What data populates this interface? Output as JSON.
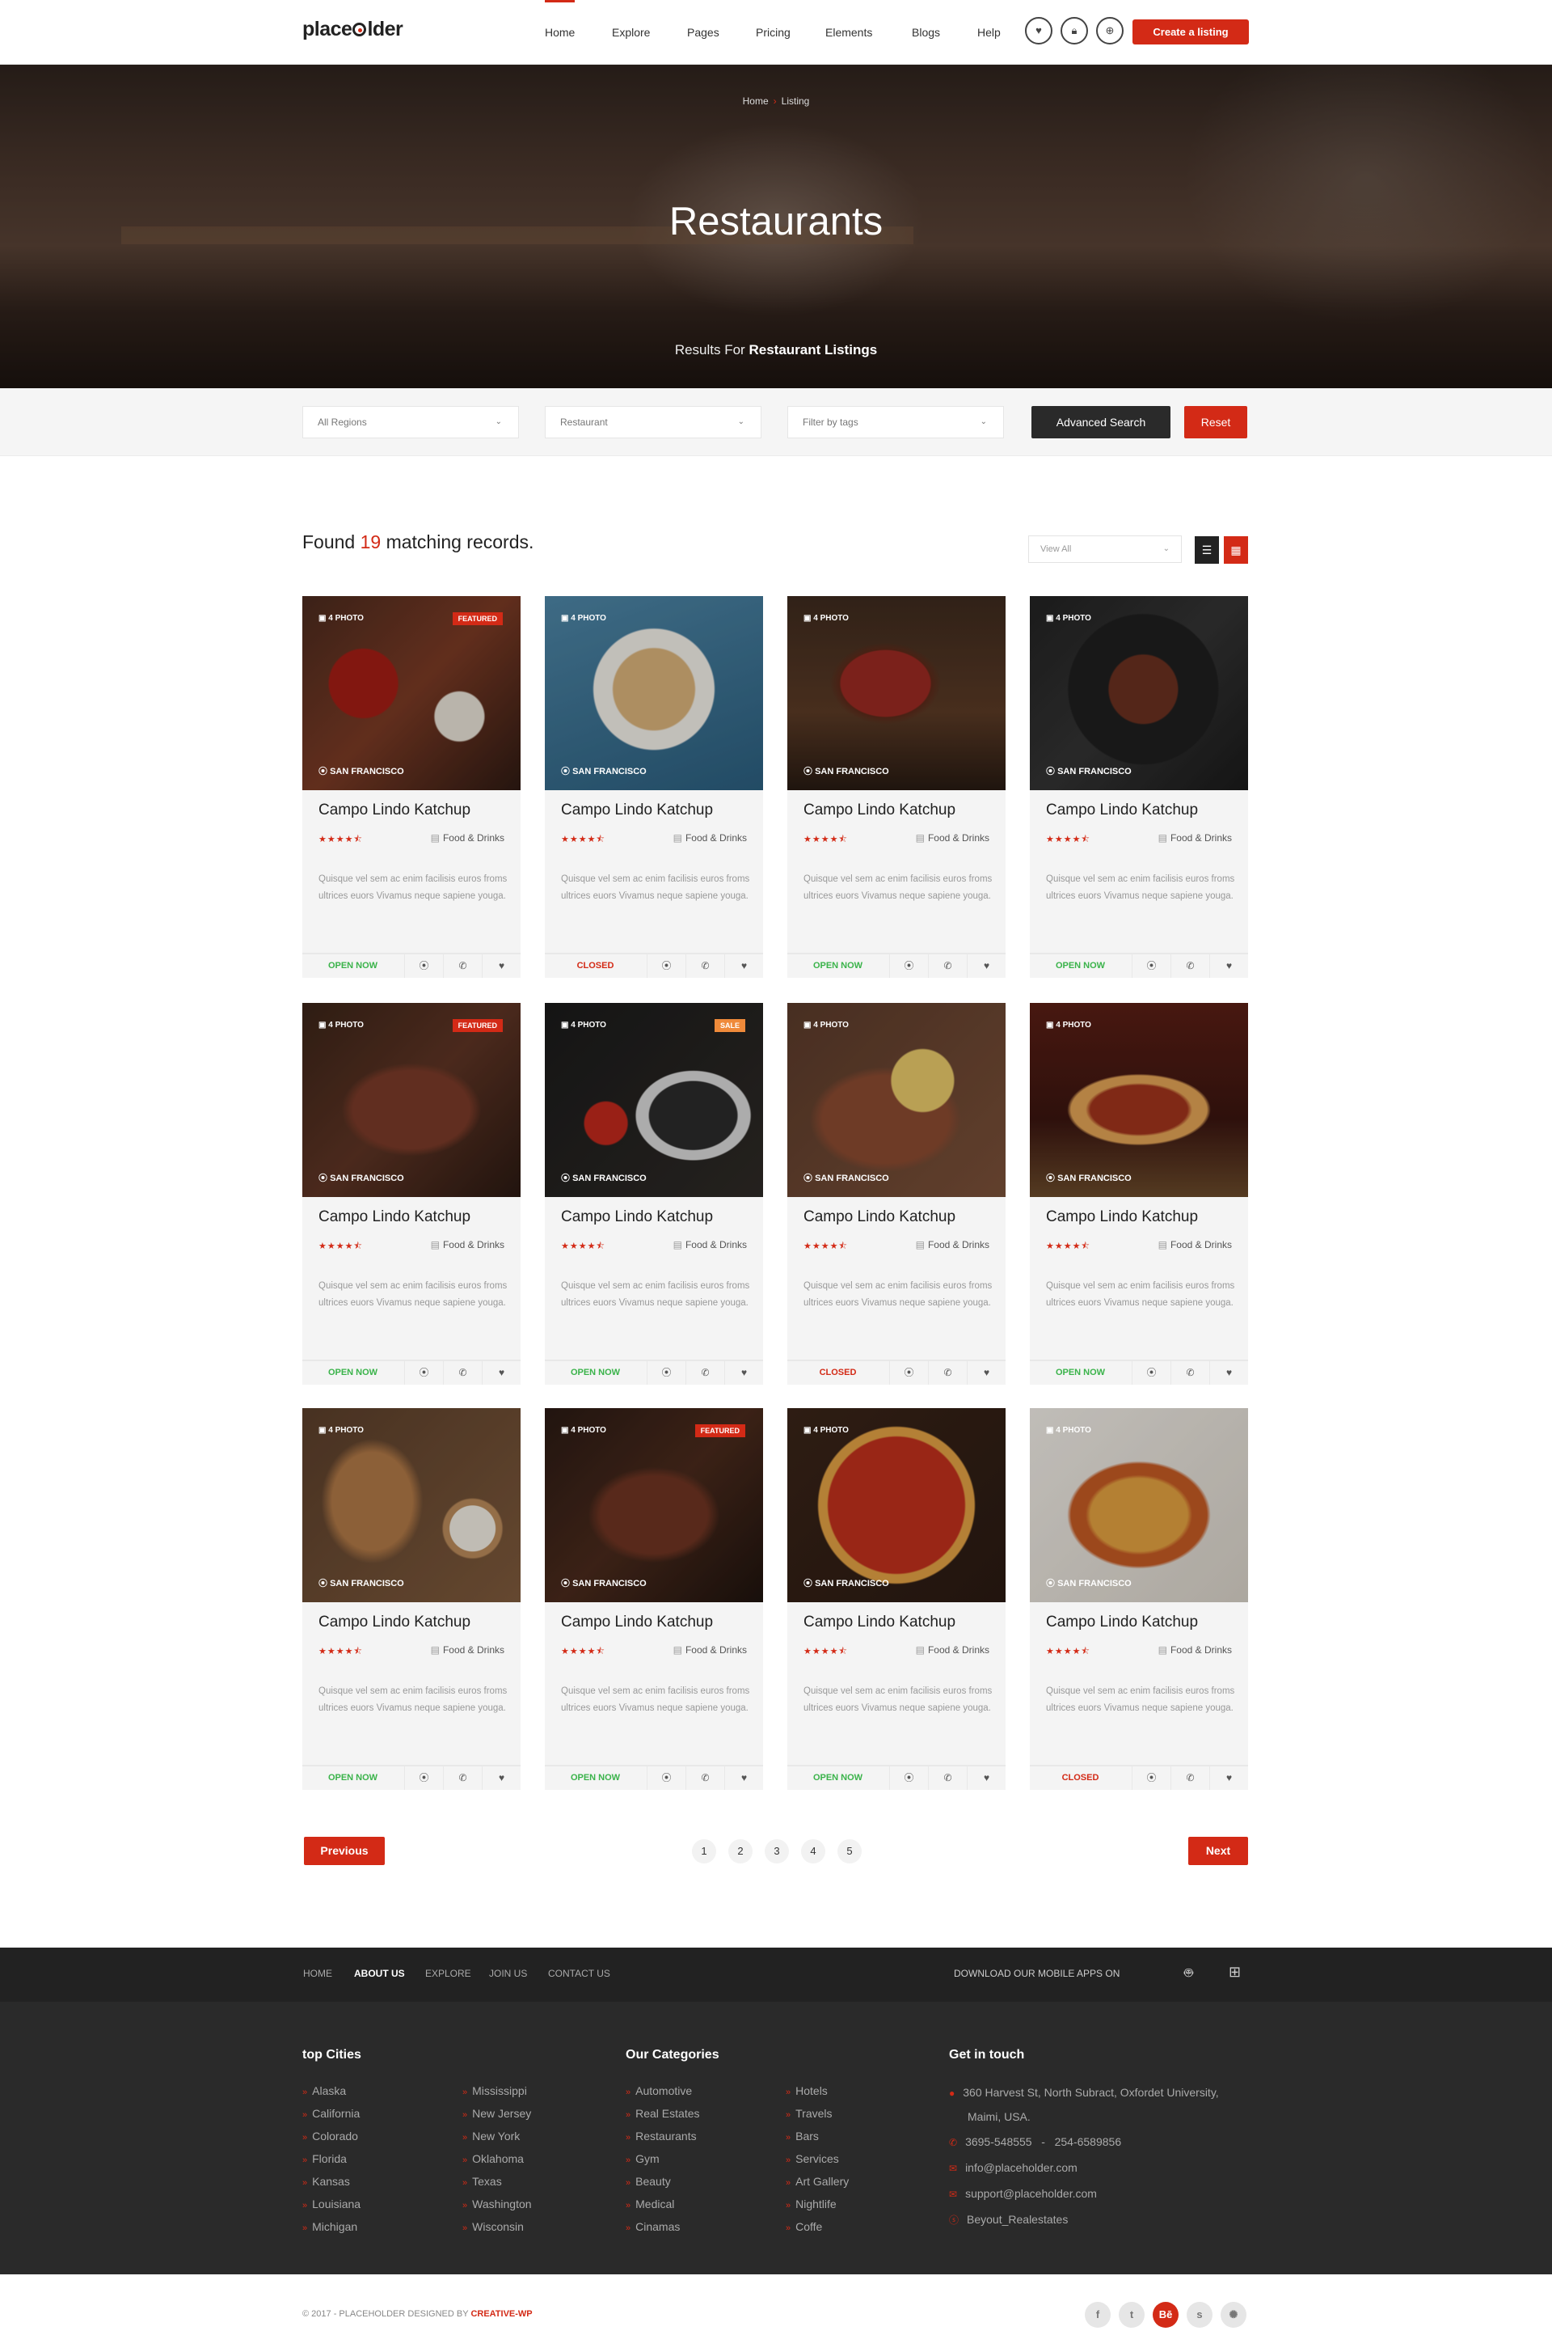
{
  "header": {
    "logo": "placeholder",
    "nav": [
      "Home",
      "Explore",
      "Pages",
      "Pricing",
      "Elements",
      "Blogs",
      "Help"
    ],
    "active": "Home",
    "create_label": "Create a listing"
  },
  "hero": {
    "breadcrumb_home": "Home",
    "breadcrumb_current": "Listing",
    "title": "Restaurants",
    "results_prefix": "Results For",
    "results_bold": "Restaurant Listings"
  },
  "filters": {
    "region": "All Regions",
    "category": "Restaurant",
    "tags": "Filter by tags",
    "advanced": "Advanced Search",
    "reset": "Reset"
  },
  "results": {
    "prefix": "Found",
    "count": "19",
    "suffix": "matching records.",
    "view": "View All"
  },
  "cards": [
    {
      "photos": "4 PHOTO",
      "badge": "FEATURED",
      "city": "SAN FRANCISCO",
      "title": "Campo Lindo Katchup",
      "stars": "★★★★⯪",
      "rating": 4.5,
      "category": "Food & Drinks",
      "desc": "Quisque vel sem ac enim facilisis euros froms ultrices euors Vivamus neque sapiene yougа.",
      "status": "OPEN NOW",
      "open": true
    },
    {
      "photos": "4 PHOTO",
      "badge": "",
      "city": "SAN FRANCISCO",
      "title": "Campo Lindo Katchup",
      "stars": "★★★★⯪",
      "rating": 4.5,
      "category": "Food & Drinks",
      "desc": "Quisque vel sem ac enim facilisis euros froms ultrices euors Vivamus neque sapiene yougа.",
      "status": "CLOSED",
      "open": false
    },
    {
      "photos": "4 PHOTO",
      "badge": "",
      "city": "SAN FRANCISCO",
      "title": "Campo Lindo Katchup",
      "stars": "★★★★⯪",
      "rating": 4.5,
      "category": "Food & Drinks",
      "desc": "Quisque vel sem ac enim facilisis euros froms ultrices euors Vivamus neque sapiene yougа.",
      "status": "OPEN NOW",
      "open": true
    },
    {
      "photos": "4 PHOTO",
      "badge": "",
      "city": "SAN FRANCISCO",
      "title": "Campo Lindo Katchup",
      "stars": "★★★★⯪",
      "rating": 4.5,
      "category": "Food & Drinks",
      "desc": "Quisque vel sem ac enim facilisis euros froms ultrices euors Vivamus neque sapiene yougа.",
      "status": "OPEN NOW",
      "open": true
    },
    {
      "photos": "4 PHOTO",
      "badge": "FEATURED",
      "city": "SAN FRANCISCO",
      "title": "Campo Lindo Katchup",
      "stars": "★★★★⯪",
      "rating": 4.5,
      "category": "Food & Drinks",
      "desc": "Quisque vel sem ac enim facilisis euros froms ultrices euors Vivamus neque sapiene yougа.",
      "status": "OPEN NOW",
      "open": true
    },
    {
      "photos": "4 PHOTO",
      "badge": "SALE",
      "city": "SAN FRANCISCO",
      "title": "Campo Lindo Katchup",
      "stars": "★★★★⯪",
      "rating": 4.5,
      "category": "Food & Drinks",
      "desc": "Quisque vel sem ac enim facilisis euros froms ultrices euors Vivamus neque sapiene yougа.",
      "status": "OPEN NOW",
      "open": true
    },
    {
      "photos": "4 PHOTO",
      "badge": "",
      "city": "SAN FRANCISCO",
      "title": "Campo Lindo Katchup",
      "stars": "★★★★⯪",
      "rating": 4.5,
      "category": "Food & Drinks",
      "desc": "Quisque vel sem ac enim facilisis euros froms ultrices euors Vivamus neque sapiene yougа.",
      "status": "CLOSED",
      "open": false
    },
    {
      "photos": "4 PHOTO",
      "badge": "",
      "city": "SAN FRANCISCO",
      "title": "Campo Lindo Katchup",
      "stars": "★★★★⯪",
      "rating": 4.5,
      "category": "Food & Drinks",
      "desc": "Quisque vel sem ac enim facilisis euros froms ultrices euors Vivamus neque sapiene yougа.",
      "status": "OPEN NOW",
      "open": true
    },
    {
      "photos": "4 PHOTO",
      "badge": "",
      "city": "SAN FRANCISCO",
      "title": "Campo Lindo Katchup",
      "stars": "★★★★⯪",
      "rating": 4.5,
      "category": "Food & Drinks",
      "desc": "Quisque vel sem ac enim facilisis euros froms ultrices euors Vivamus neque sapiene yougа.",
      "status": "OPEN NOW",
      "open": true
    },
    {
      "photos": "4 PHOTO",
      "badge": "FEATURED",
      "city": "SAN FRANCISCO",
      "title": "Campo Lindo Katchup",
      "stars": "★★★★⯪",
      "rating": 4.5,
      "category": "Food & Drinks",
      "desc": "Quisque vel sem ac enim facilisis euros froms ultrices euors Vivamus neque sapiene yougа.",
      "status": "OPEN NOW",
      "open": true
    },
    {
      "photos": "4 PHOTO",
      "badge": "",
      "city": "SAN FRANCISCO",
      "title": "Campo Lindo Katchup",
      "stars": "★★★★⯪",
      "rating": 4.5,
      "category": "Food & Drinks",
      "desc": "Quisque vel sem ac enim facilisis euros froms ultrices euors Vivamus neque sapiene yougа.",
      "status": "OPEN NOW",
      "open": true
    },
    {
      "photos": "4 PHOTO",
      "badge": "",
      "city": "SAN FRANCISCO",
      "title": "Campo Lindo Katchup",
      "stars": "★★★★⯪",
      "rating": 4.5,
      "category": "Food & Drinks",
      "desc": "Quisque vel sem ac enim facilisis euros froms ultrices euors Vivamus neque sapiene yougа.",
      "status": "CLOSED",
      "open": false
    }
  ],
  "pagination": {
    "prev": "Previous",
    "next": "Next",
    "pages": [
      "1",
      "2",
      "3",
      "4",
      "5"
    ]
  },
  "footer": {
    "nav": [
      "HOME",
      "ABOUT US",
      "EXPLORE",
      "JOIN US",
      "CONTACT US"
    ],
    "nav_active": "ABOUT US",
    "apps_label": "DOWNLOAD OUR MOBILE APPS ON",
    "cities_title": "top Cities",
    "cities_a": [
      "Alaska",
      "California",
      "Colorado",
      "Florida",
      "Kansas",
      "Louisiana",
      "Michigan"
    ],
    "cities_b": [
      "Mississippi",
      "New Jersey",
      "New York",
      "Oklahoma",
      "Texas",
      "Washington",
      "Wisconsin"
    ],
    "categories_title": "Our Categories",
    "cats_a": [
      "Automotive",
      "Real Estates",
      "Restaurants",
      "Gym",
      "Beauty",
      "Medical",
      "Cinamas"
    ],
    "cats_b": [
      "Hotels",
      "Travels",
      "Bars",
      "Services",
      "Art Gallery",
      "Nightlife",
      "Coffe"
    ],
    "contact_title": "Get in touch",
    "address_1": "360 Harvest St, North Subract, Oxfordet University,",
    "address_2": "Maimi, USA.",
    "phone": "3695-548555   -   254-6589856",
    "email_1": "info@placeholder.com",
    "email_2": "support@placeholder.com",
    "skype": "Beyout_Realestates",
    "copyright_prefix": "© 2017 - PLACEHOLDER DESIGNED BY",
    "copyright_brand": "CREATIVE-WP",
    "social": [
      "f",
      "t",
      "Bē",
      "s",
      "✺"
    ]
  },
  "colors": {
    "accent": "#d32a16",
    "open": "#3ab34a",
    "footer_dark": "#2a2a2a"
  }
}
